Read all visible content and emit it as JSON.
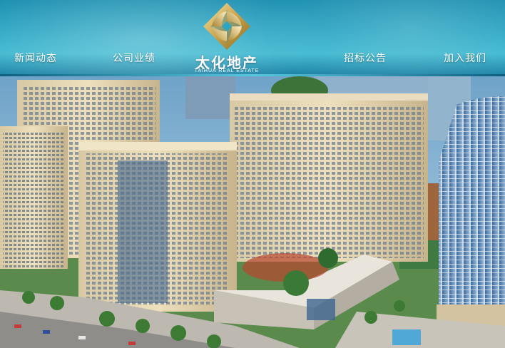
{
  "header": {
    "nav_left": [
      {
        "label": "新闻动态"
      },
      {
        "label": "公司业绩"
      }
    ],
    "nav_right": [
      {
        "label": "招标公告"
      },
      {
        "label": "加入我们"
      }
    ],
    "logo": {
      "name_cn": "太化地产",
      "name_en": "TAIHUA REAL ESTATE"
    }
  },
  "colors": {
    "header": "#2aa5c3",
    "logo_gold": "#c9a24a",
    "nav_text": "#ffffff"
  }
}
